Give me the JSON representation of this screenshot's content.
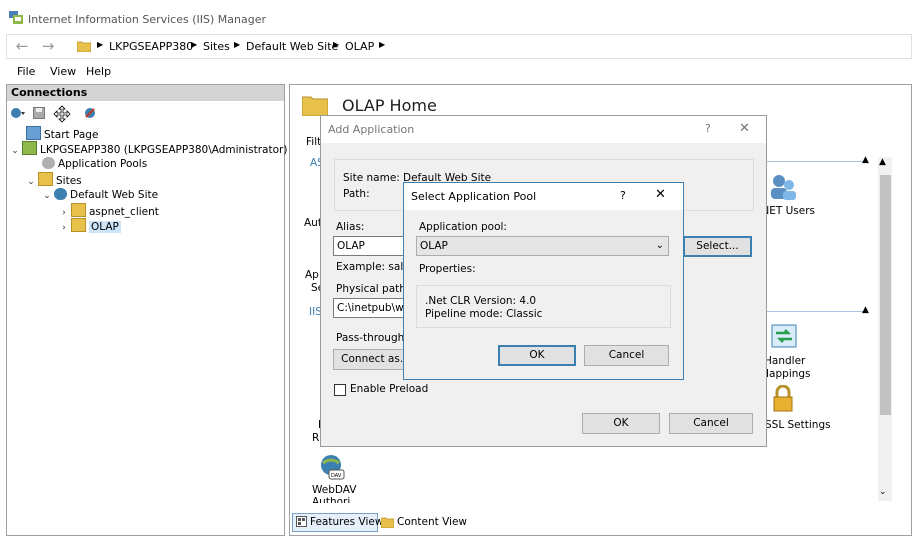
{
  "window": {
    "title": "Internet Information Services (IIS) Manager"
  },
  "address": {
    "crumbs": [
      "LKPGSEAPP380",
      "Sites",
      "Default Web Site",
      "OLAP"
    ]
  },
  "menu": {
    "file": "File",
    "view": "View",
    "help": "Help"
  },
  "connections": {
    "header": "Connections",
    "tree": {
      "start_page": "Start Page",
      "server": "LKPGSEAPP380 (LKPGSEAPP380\\Administrator)",
      "app_pools": "Application Pools",
      "sites": "Sites",
      "default_site": "Default Web Site",
      "aspnet_client": "aspnet_client",
      "olap": "OLAP"
    }
  },
  "main": {
    "title": "OLAP Home",
    "filter_partial": "Filt",
    "asp_partial": "AS",
    "aut_partial": "Aut",
    "ap_partial": "Ap",
    "se_partial": "Se",
    "iis_partial": "IIS",
    "r_partial": "R",
    "i_partial": "I",
    "net_users": ".NET Users",
    "handler_mappings_1": "Handler",
    "handler_mappings_2": "Mappings",
    "ssl_settings": "SSL Settings",
    "webdav_1": "WebDAV",
    "webdav_2": "Authori..."
  },
  "status": {
    "features_view": "Features View",
    "content_view": "Content View"
  },
  "add_app": {
    "title": "Add Application",
    "help": "?",
    "close": "✕",
    "site_name_label": "Site name:",
    "site_name_value": "Default Web Site",
    "path_label": "Path:",
    "path_value": "/",
    "alias_label": "Alias:",
    "alias_value": "OLAP",
    "example": "Example: sales",
    "physical_path_label": "Physical path:",
    "physical_path_value": "C:\\inetpub\\www",
    "pass_through_label": "Pass-through a",
    "connect_as": "Connect as...",
    "select_button": "Select...",
    "enable_preload": "Enable Preload",
    "ok": "OK",
    "cancel": "Cancel"
  },
  "select_pool": {
    "title": "Select Application Pool",
    "help": "?",
    "close": "✕",
    "pool_label": "Application pool:",
    "pool_value": "OLAP",
    "properties_label": "Properties:",
    "clr_version": ".Net CLR Version: 4.0",
    "pipeline_mode": "Pipeline mode: Classic",
    "ok": "OK",
    "cancel": "Cancel"
  },
  "colors": {
    "accent": "#3c7fb1",
    "folder": "#e8c14a"
  }
}
